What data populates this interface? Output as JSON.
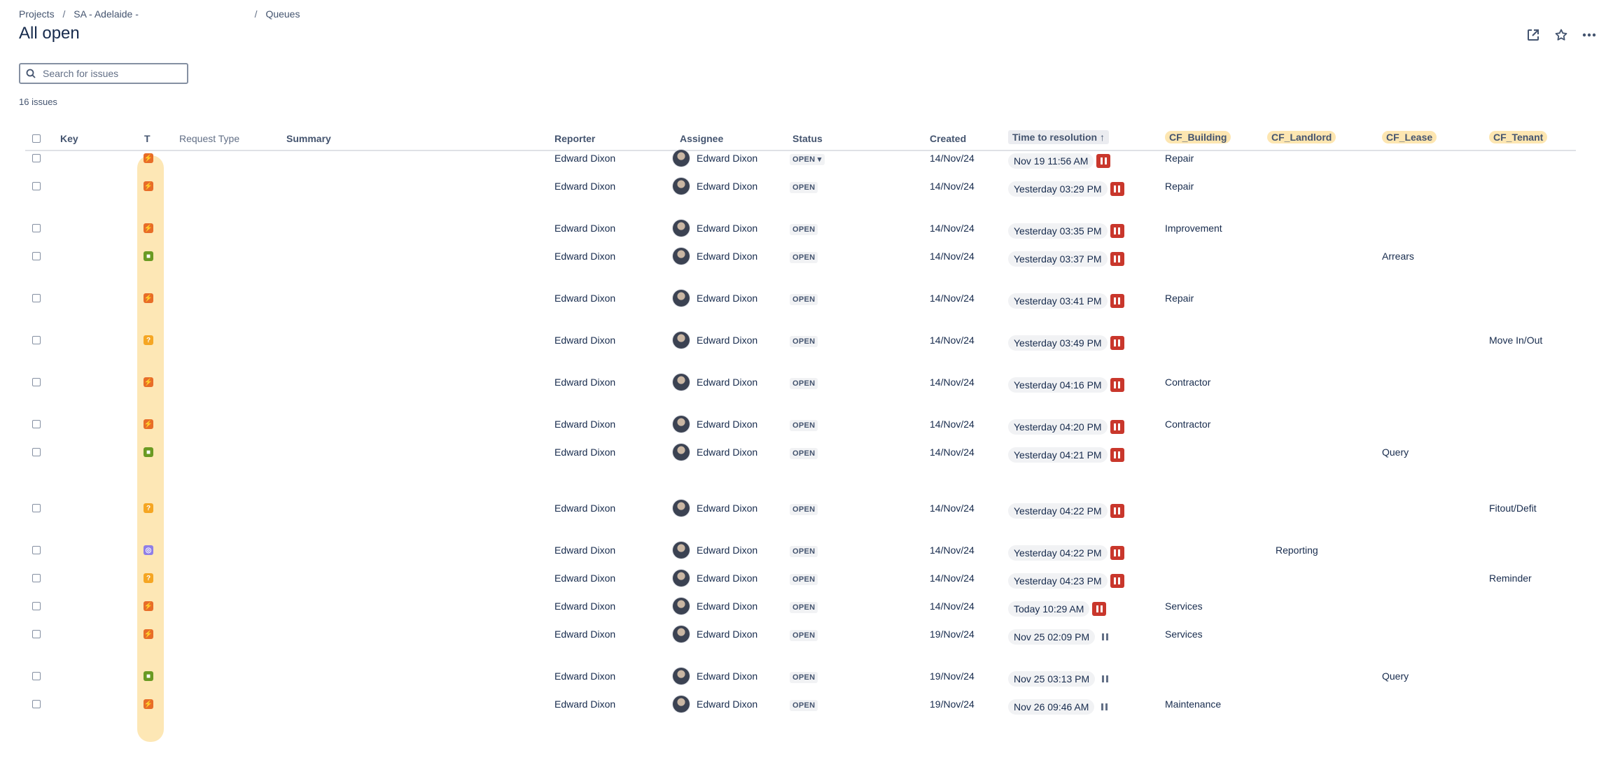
{
  "breadcrumb": {
    "projects": "Projects",
    "project": "SA - Adelaide -",
    "queues": "Queues"
  },
  "page_title": "All open",
  "search": {
    "placeholder": "Search for issues"
  },
  "issue_count": "16 issues",
  "columns": {
    "key": "Key",
    "type": "T",
    "request_type": "Request Type",
    "summary": "Summary",
    "reporter": "Reporter",
    "assignee": "Assignee",
    "status": "Status",
    "created": "Created",
    "time_to_resolution": "Time to resolution",
    "cf_building": "CF_Building",
    "cf_landlord": "CF_Landlord",
    "cf_lease": "CF_Lease",
    "cf_tenant": "CF_Tenant"
  },
  "colors": {
    "icon_orange": "#e86d28",
    "icon_green": "#6a9a23",
    "icon_yellow": "#f5a623",
    "icon_purple": "#8f7ee7",
    "pause_red": "#c9372c",
    "highlight": "#fde6b1"
  },
  "rows": [
    {
      "type_icon": "orange",
      "type_glyph": "⚡",
      "reporter": "Edward Dixon",
      "assignee": "Edward Dixon",
      "status": "OPEN",
      "status_dropdown": true,
      "created": "14/Nov/24",
      "sla": "Nov 19 11:56 AM",
      "pause": "red",
      "cf_building": "Repair",
      "cf_landlord": "",
      "cf_lease": "",
      "cf_tenant": ""
    },
    {
      "type_icon": "orange",
      "type_glyph": "⚡",
      "reporter": "Edward Dixon",
      "assignee": "Edward Dixon",
      "status": "OPEN",
      "created": "14/Nov/24",
      "sla": "Yesterday 03:29 PM",
      "pause": "red",
      "cf_building": "Repair",
      "cf_landlord": "",
      "cf_lease": "",
      "cf_tenant": ""
    },
    {
      "type_icon": "orange",
      "type_glyph": "⚡",
      "reporter": "Edward Dixon",
      "assignee": "Edward Dixon",
      "status": "OPEN",
      "created": "14/Nov/24",
      "sla": "Yesterday 03:35 PM",
      "pause": "red",
      "cf_building": "Improvement",
      "cf_landlord": "",
      "cf_lease": "",
      "cf_tenant": ""
    },
    {
      "type_icon": "green",
      "type_glyph": "■",
      "reporter": "Edward Dixon",
      "assignee": "Edward Dixon",
      "status": "OPEN",
      "created": "14/Nov/24",
      "sla": "Yesterday 03:37 PM",
      "pause": "red",
      "cf_building": "",
      "cf_landlord": "",
      "cf_lease": "Arrears",
      "cf_tenant": ""
    },
    {
      "type_icon": "orange",
      "type_glyph": "⚡",
      "reporter": "Edward Dixon",
      "assignee": "Edward Dixon",
      "status": "OPEN",
      "created": "14/Nov/24",
      "sla": "Yesterday 03:41 PM",
      "pause": "red",
      "cf_building": "Repair",
      "cf_landlord": "",
      "cf_lease": "",
      "cf_tenant": ""
    },
    {
      "type_icon": "yellow",
      "type_glyph": "?",
      "reporter": "Edward Dixon",
      "assignee": "Edward Dixon",
      "status": "OPEN",
      "created": "14/Nov/24",
      "sla": "Yesterday 03:49 PM",
      "pause": "red",
      "cf_building": "",
      "cf_landlord": "",
      "cf_lease": "",
      "cf_tenant": "Move In/Out"
    },
    {
      "type_icon": "orange",
      "type_glyph": "⚡",
      "reporter": "Edward Dixon",
      "assignee": "Edward Dixon",
      "status": "OPEN",
      "created": "14/Nov/24",
      "sla": "Yesterday 04:16 PM",
      "pause": "red",
      "cf_building": "Contractor",
      "cf_landlord": "",
      "cf_lease": "",
      "cf_tenant": ""
    },
    {
      "type_icon": "orange",
      "type_glyph": "⚡",
      "reporter": "Edward Dixon",
      "assignee": "Edward Dixon",
      "status": "OPEN",
      "created": "14/Nov/24",
      "sla": "Yesterday 04:20 PM",
      "pause": "red",
      "cf_building": "Contractor",
      "cf_landlord": "",
      "cf_lease": "",
      "cf_tenant": ""
    },
    {
      "type_icon": "green",
      "type_glyph": "■",
      "reporter": "Edward Dixon",
      "assignee": "Edward Dixon",
      "status": "OPEN",
      "created": "14/Nov/24",
      "sla": "Yesterday 04:21 PM",
      "pause": "red",
      "cf_building": "",
      "cf_landlord": "",
      "cf_lease": "Query",
      "cf_tenant": ""
    },
    {
      "type_icon": "yellow",
      "type_glyph": "?",
      "reporter": "Edward Dixon",
      "assignee": "Edward Dixon",
      "status": "OPEN",
      "created": "14/Nov/24",
      "sla": "Yesterday 04:22 PM",
      "pause": "red",
      "cf_building": "",
      "cf_landlord": "",
      "cf_lease": "",
      "cf_tenant": "Fitout/Defit"
    },
    {
      "type_icon": "purple",
      "type_glyph": "◎",
      "reporter": "Edward Dixon",
      "assignee": "Edward Dixon",
      "status": "OPEN",
      "created": "14/Nov/24",
      "sla": "Yesterday 04:22 PM",
      "pause": "red",
      "cf_building": "",
      "cf_landlord": "Reporting",
      "cf_lease": "",
      "cf_tenant": ""
    },
    {
      "type_icon": "yellow",
      "type_glyph": "?",
      "reporter": "Edward Dixon",
      "assignee": "Edward Dixon",
      "status": "OPEN",
      "created": "14/Nov/24",
      "sla": "Yesterday 04:23 PM",
      "pause": "red",
      "cf_building": "",
      "cf_landlord": "",
      "cf_lease": "",
      "cf_tenant": "Reminder"
    },
    {
      "type_icon": "orange",
      "type_glyph": "⚡",
      "reporter": "Edward Dixon",
      "assignee": "Edward Dixon",
      "status": "OPEN",
      "created": "14/Nov/24",
      "sla": "Today 10:29 AM",
      "pause": "red",
      "cf_building": "Services",
      "cf_landlord": "",
      "cf_lease": "",
      "cf_tenant": ""
    },
    {
      "type_icon": "orange",
      "type_glyph": "⚡",
      "reporter": "Edward Dixon",
      "assignee": "Edward Dixon",
      "status": "OPEN",
      "created": "19/Nov/24",
      "sla": "Nov 25 02:09 PM",
      "pause": "grey",
      "cf_building": "Services",
      "cf_landlord": "",
      "cf_lease": "",
      "cf_tenant": ""
    },
    {
      "type_icon": "green",
      "type_glyph": "■",
      "reporter": "Edward Dixon",
      "assignee": "Edward Dixon",
      "status": "OPEN",
      "created": "19/Nov/24",
      "sla": "Nov 25 03:13 PM",
      "pause": "grey",
      "cf_building": "",
      "cf_landlord": "",
      "cf_lease": "Query",
      "cf_tenant": ""
    },
    {
      "type_icon": "orange",
      "type_glyph": "⚡",
      "reporter": "Edward Dixon",
      "assignee": "Edward Dixon",
      "status": "OPEN",
      "created": "19/Nov/24",
      "sla": "Nov 26 09:46 AM",
      "pause": "grey",
      "cf_building": "Maintenance",
      "cf_landlord": "",
      "cf_lease": "",
      "cf_tenant": ""
    }
  ]
}
